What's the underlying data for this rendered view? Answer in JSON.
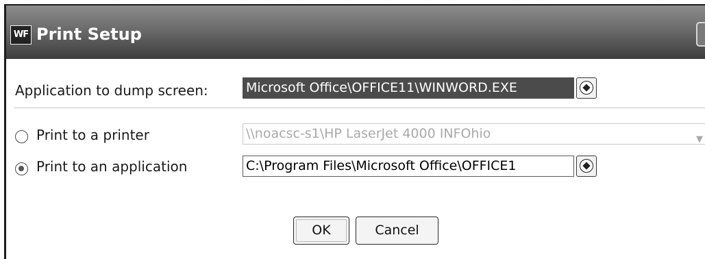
{
  "window": {
    "title": "Print Setup",
    "app_icon_text": "WF"
  },
  "dump": {
    "label": "Application to dump screen:",
    "value": "Microsoft Office\\OFFICE11\\WINWORD.EXE"
  },
  "print_printer": {
    "label": "Print to a printer",
    "value": "\\\\noacsc-s1\\HP LaserJet 4000 INFOhio",
    "checked": false
  },
  "print_app": {
    "label": "Print to an application",
    "value": "C:\\Program Files\\Microsoft Office\\OFFICE1",
    "checked": true
  },
  "buttons": {
    "ok": "OK",
    "cancel": "Cancel"
  },
  "icons": {
    "browse": "browse-gem-icon",
    "app": "wf-app-icon",
    "close": "close-icon",
    "dropdown": "chevron-down-icon"
  }
}
